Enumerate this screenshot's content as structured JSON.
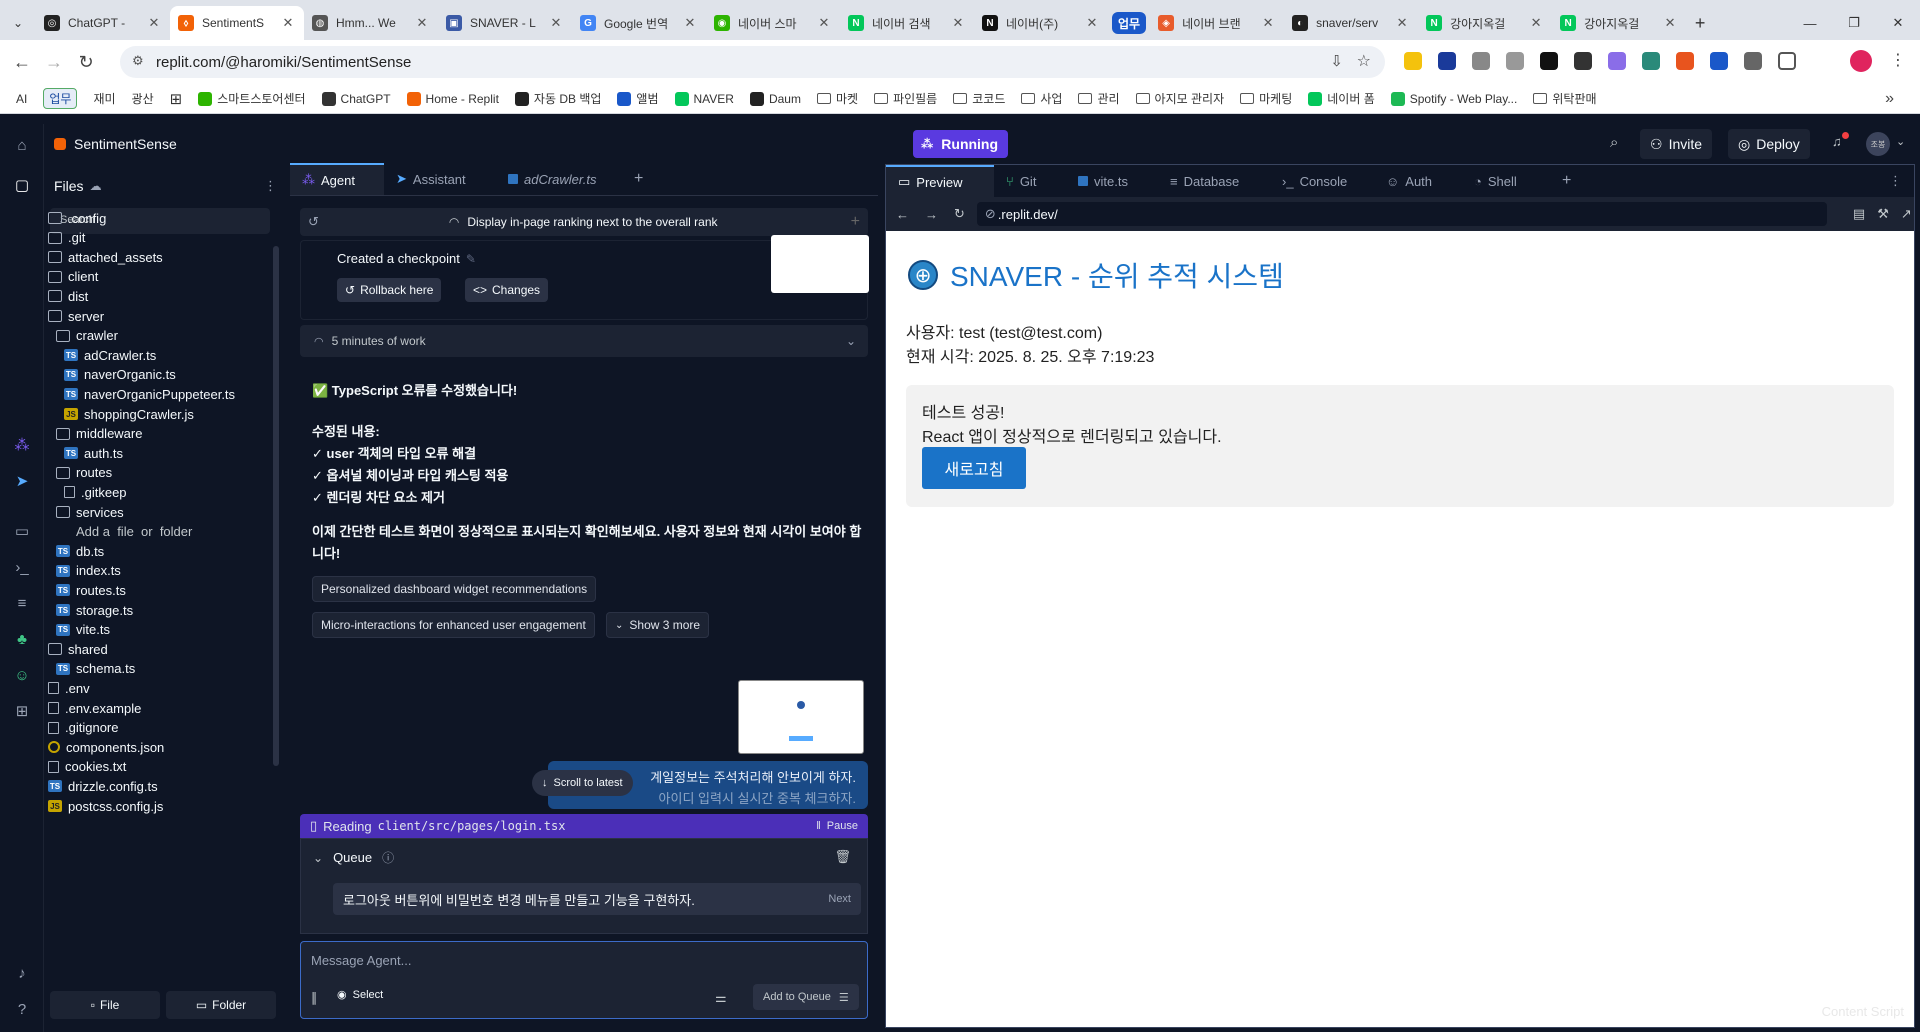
{
  "browser": {
    "tabs": [
      {
        "title": "ChatGPT - ",
        "color": "#222222",
        "glyph": "◎"
      },
      {
        "title": "SentimentS",
        "color": "#f26207",
        "glyph": "⬨"
      },
      {
        "title": "Hmm... We",
        "color": "#555555",
        "glyph": "◍"
      },
      {
        "title": "SNAVER - L",
        "color": "#3b5aa6",
        "glyph": "▣"
      },
      {
        "title": "Google 번역",
        "color": "#4285f4",
        "glyph": "G"
      },
      {
        "title": "네이버 스마",
        "color": "#2db400",
        "glyph": "◉"
      },
      {
        "title": "네이버 검색",
        "color": "#03c75a",
        "glyph": "N"
      },
      {
        "title": "네이버(주)",
        "color": "#111111",
        "glyph": "N"
      },
      {
        "title": "네이버 브랜",
        "color": "#e85c2c",
        "glyph": "◈"
      },
      {
        "title": "snaver/serv",
        "color": "#222222",
        "glyph": "◐"
      },
      {
        "title": "강아지옥걸",
        "color": "#03c75a",
        "glyph": "N"
      },
      {
        "title": "강아지옥걸",
        "color": "#03c75a",
        "glyph": "N"
      }
    ],
    "group_label": "업무",
    "url": "replit.com/@haromiki/SentimentSense",
    "bookmarks": [
      {
        "label": "AI",
        "color": ""
      },
      {
        "label": "업무",
        "color": "",
        "pill": true
      },
      {
        "label": "재미",
        "color": ""
      },
      {
        "label": "광산",
        "color": ""
      },
      {
        "label": "",
        "color": "#555555",
        "grid": true
      },
      {
        "label": "스마트스토어센터",
        "color": "#2db400"
      },
      {
        "label": "ChatGPT",
        "color": "#333333"
      },
      {
        "label": "Home - Replit",
        "color": "#f26207"
      },
      {
        "label": "자동 DB 백업",
        "color": "#222222"
      },
      {
        "label": "앨범",
        "color": "#1a58c9"
      },
      {
        "label": "NAVER",
        "color": "#03c75a"
      },
      {
        "label": "Daum",
        "color": "#222222"
      },
      {
        "label": "마켓",
        "color": "",
        "folder": true
      },
      {
        "label": "파인필름",
        "color": "",
        "folder": true
      },
      {
        "label": "코코드",
        "color": "",
        "folder": true
      },
      {
        "label": "사업",
        "color": "",
        "folder": true
      },
      {
        "label": "관리",
        "color": "",
        "folder": true
      },
      {
        "label": "아지모 관리자",
        "color": "",
        "folder": true
      },
      {
        "label": "마케팅",
        "color": "",
        "folder": true
      },
      {
        "label": "네이버 폼",
        "color": "#03c75a"
      },
      {
        "label": "Spotify - Web Play...",
        "color": "#1db954"
      },
      {
        "label": "위탁판매",
        "color": "",
        "folder": true
      }
    ]
  },
  "replit": {
    "project_name": "SentimentSense",
    "run_label": "Running",
    "invite_label": "Invite",
    "deploy_label": "Deploy",
    "avatar_text": "조봉"
  },
  "files": {
    "header": "Files",
    "search_placeholder": "Search",
    "tree": [
      {
        "name": ".config",
        "type": "folder",
        "depth": 0
      },
      {
        "name": ".git",
        "type": "folder",
        "depth": 0
      },
      {
        "name": "attached_assets",
        "type": "folder",
        "depth": 0
      },
      {
        "name": "client",
        "type": "folder",
        "depth": 0
      },
      {
        "name": "dist",
        "type": "folder",
        "depth": 0
      },
      {
        "name": "server",
        "type": "folder",
        "depth": 0
      },
      {
        "name": "crawler",
        "type": "folder",
        "depth": 1
      },
      {
        "name": "adCrawler.ts",
        "type": "ts",
        "depth": 2
      },
      {
        "name": "naverOrganic.ts",
        "type": "ts",
        "depth": 2
      },
      {
        "name": "naverOrganicPuppeteer.ts",
        "type": "ts",
        "depth": 2
      },
      {
        "name": "shoppingCrawler.js",
        "type": "js",
        "depth": 2
      },
      {
        "name": "middleware",
        "type": "folder",
        "depth": 1
      },
      {
        "name": "auth.ts",
        "type": "ts",
        "depth": 2
      },
      {
        "name": "routes",
        "type": "folder",
        "depth": 1
      },
      {
        "name": ".gitkeep",
        "type": "file",
        "depth": 2
      },
      {
        "name": "services",
        "type": "folder",
        "depth": 1
      },
      {
        "name": "Add a  file  or  folder",
        "type": "add",
        "depth": 2
      },
      {
        "name": "db.ts",
        "type": "ts",
        "depth": 1
      },
      {
        "name": "index.ts",
        "type": "ts",
        "depth": 1
      },
      {
        "name": "routes.ts",
        "type": "ts",
        "depth": 1
      },
      {
        "name": "storage.ts",
        "type": "ts",
        "depth": 1
      },
      {
        "name": "vite.ts",
        "type": "ts",
        "depth": 1
      },
      {
        "name": "shared",
        "type": "folder",
        "depth": 0
      },
      {
        "name": "schema.ts",
        "type": "ts",
        "depth": 1
      },
      {
        "name": ".env",
        "type": "file",
        "depth": 0
      },
      {
        "name": ".env.example",
        "type": "file",
        "depth": 0
      },
      {
        "name": ".gitignore",
        "type": "file",
        "depth": 0
      },
      {
        "name": "components.json",
        "type": "json",
        "depth": 0
      },
      {
        "name": "cookies.txt",
        "type": "file",
        "depth": 0
      },
      {
        "name": "drizzle.config.ts",
        "type": "ts",
        "depth": 0
      },
      {
        "name": "postcss.config.js",
        "type": "js",
        "depth": 0
      }
    ],
    "new_file": "File",
    "new_folder": "Folder"
  },
  "agent": {
    "tabs": [
      "Agent",
      "Assistant",
      "adCrawler.ts"
    ],
    "thread_title": "Display in-page ranking next to the overall rank",
    "checkpoint_label": "Created a checkpoint",
    "rollback_label": "Rollback here",
    "changes_label": "Changes",
    "work_label": "5 minutes of work",
    "heading": "✅ TypeScript 오류를 수정했습니다!",
    "fixed_title": "수정된 내용:",
    "fixed_items": [
      "✓ user 객체의 타입 오류 해결",
      "✓ 옵셔널 체이닝과 타입 캐스팅 적용",
      "✓ 렌더링 차단 요소 제거"
    ],
    "closing": "이제 간단한 테스트 화면이 정상적으로 표시되는지 확인해보세요. 사용자 정보와 현재 시각이 보여야 합니다!",
    "suggestions": [
      "Personalized dashboard widget recommendations",
      "Micro-interactions for enhanced user engagement"
    ],
    "show_more": "Show 3 more",
    "user_msg_line1": "계일정보는 주석처리해 안보이게 하자.",
    "user_msg_line2": "아이디 입력시 실시간 중복 체크하자.",
    "scroll_label": "Scroll to latest",
    "reading_prefix": "Reading",
    "reading_path": "client/src/pages/login.tsx",
    "pause_label": "Pause",
    "queue_label": "Queue",
    "queue_item": "로그아웃 버튼위에 비밀번호 변경 메뉴를 만들고 기능을 구현하자.",
    "queue_next": "Next",
    "input_placeholder": "Message Agent...",
    "select_label": "Select",
    "add_queue_label": "Add to Queue"
  },
  "preview": {
    "tabs": [
      "Preview",
      "Git",
      "vite.ts",
      "Database",
      "Console",
      "Auth",
      "Shell"
    ],
    "url": ".replit.dev/",
    "title": "SNAVER - 순위 추적 시스템",
    "user_line": "사용자: test (test@test.com)",
    "time_line": "현재 시각: 2025. 8. 25. 오후 7:19:23",
    "box_line1": "테스트 성공!",
    "box_line2": "React 앱이 정상적으로 렌더링되고 있습니다.",
    "refresh_label": "새로고침",
    "content_script": "Content Script",
    "title_color": "#1a73c8",
    "button_color": "#1a73c8"
  }
}
